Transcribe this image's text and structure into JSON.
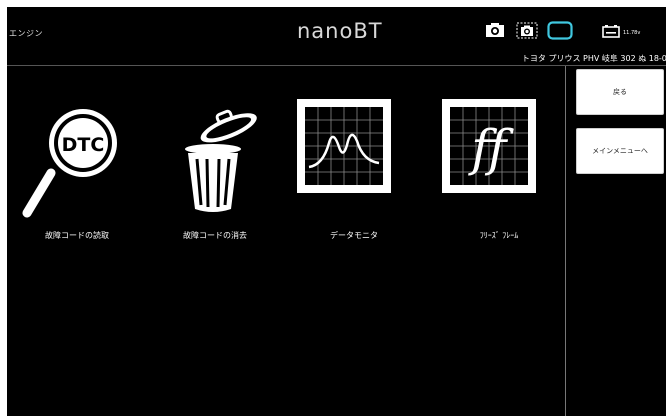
{
  "header": {
    "mode_label": "エンジン",
    "app_title": "nanoBT",
    "battery_voltage": "11.78v",
    "vehicle_info": "トヨタ プリウス PHV 岐阜 302 ぬ 18-02",
    "icons": [
      "camera-icon",
      "screenshot-icon",
      "connection-icon",
      "battery-icon"
    ]
  },
  "functions": [
    {
      "label": "故障コードの読取",
      "icon": "dtc-magnifier-icon",
      "icon_text": "DTC"
    },
    {
      "label": "故障コードの消去",
      "icon": "trash-can-icon"
    },
    {
      "label": "データモニタ",
      "icon": "data-monitor-graph-icon"
    },
    {
      "label": "ﾌﾘｰｽﾞ ﾌﾚｰﾑ",
      "icon": "freeze-frame-icon",
      "icon_text": "ff"
    }
  ],
  "sidebar": {
    "back_label": "戻る",
    "main_menu_label": "メインメニューへ"
  },
  "colors": {
    "background": "#000000",
    "text": "#ffffff",
    "accent": "#40c8e0",
    "button_bg": "#ffffff"
  }
}
